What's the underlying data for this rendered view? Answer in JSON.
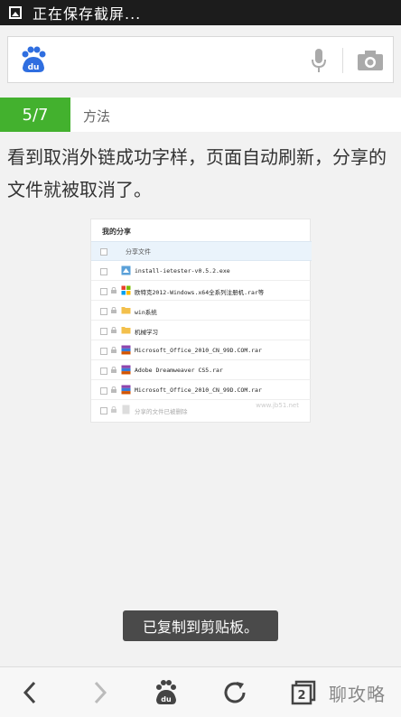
{
  "status_bar": {
    "text": "正在保存截屏..."
  },
  "search": {
    "logo": "du",
    "voice_icon": "microphone-icon",
    "camera_icon": "camera-icon"
  },
  "step": {
    "number": "5/7",
    "label": "方法"
  },
  "description": "看到取消外链成功字样，页面自动刷新，分享的文件就被取消了。",
  "share_panel": {
    "title": "我的分享",
    "header": "分享文件",
    "files": [
      {
        "name": "install-ietester-v0.5.2.exe",
        "icon": "exe-file-icon",
        "locked": false
      },
      {
        "name": "欧特克2012-Windows.x64全系列注册机.rar等",
        "icon": "windows-file-icon",
        "locked": true
      },
      {
        "name": "win系统",
        "icon": "folder-icon",
        "locked": true
      },
      {
        "name": "机械学习",
        "icon": "folder-icon",
        "locked": true
      },
      {
        "name": "Microsoft_Office_2010_CN_99D.COM.rar",
        "icon": "archive-file-icon",
        "locked": true
      },
      {
        "name": "Adobe Dreamweaver CS5.rar",
        "icon": "archive-file-icon",
        "locked": true
      },
      {
        "name": "Microsoft_Office_2010_CN_99D.COM.rar",
        "icon": "archive-file-icon",
        "locked": true
      },
      {
        "name": "分享的文件已被删除",
        "icon": "deleted-file-icon",
        "locked": true
      }
    ],
    "watermark": "www.jb51.net"
  },
  "toast": "已复制到剪贴板。",
  "bottom_nav": {
    "back": "back-icon",
    "forward": "forward-icon",
    "home": "baidu-paw-icon",
    "refresh": "refresh-icon",
    "tabs_count": "2",
    "brand": "聊攻略"
  },
  "colors": {
    "step_green": "#43b12e",
    "baidu_blue": "#2f6ee0"
  }
}
